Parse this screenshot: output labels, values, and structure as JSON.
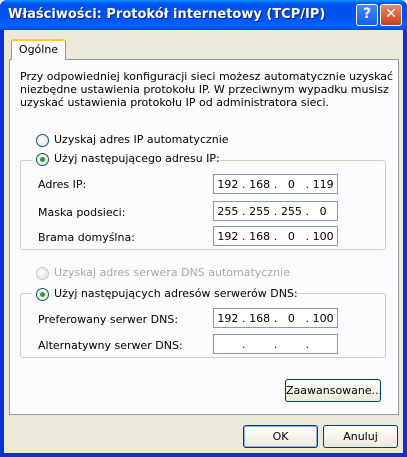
{
  "window": {
    "title": "Właściwości: Protokół internetowy (TCP/IP)",
    "help_symbol": "?",
    "close_symbol": "✕"
  },
  "tab": {
    "label": "Ogólne"
  },
  "description": [
    "Przy odpowiedniej konfiguracji sieci możesz automatycznie uzyskać",
    "niezbędne ustawienia protokołu IP. W przeciwnym wypadku musisz",
    "uzyskać ustawienia protokołu IP od administratora sieci."
  ],
  "ip_mode": {
    "auto_label": "Uzyskaj adres IP automatycznie",
    "manual_label": "Użyj następującego adresu IP:",
    "selected": "manual"
  },
  "ip_fields": {
    "address": {
      "label": "Adres IP:",
      "octets": [
        "192",
        "168",
        "0",
        "119"
      ]
    },
    "mask": {
      "label": "Maska podsieci:",
      "octets": [
        "255",
        "255",
        "255",
        "0"
      ]
    },
    "gateway": {
      "label": "Brama domyślna:",
      "octets": [
        "192",
        "168",
        "0",
        "100"
      ]
    }
  },
  "dns_mode": {
    "auto_label": "Uzyskaj adres serwera DNS automatycznie",
    "manual_label": "Użyj następujących adresów serwerów DNS:",
    "selected": "manual",
    "auto_disabled": true
  },
  "dns_fields": {
    "preferred": {
      "label": "Preferowany serwer DNS:",
      "octets": [
        "192",
        "168",
        "0",
        "100"
      ]
    },
    "alternate": {
      "label": "Alternatywny serwer DNS:",
      "octets": [
        "",
        "",
        "",
        ""
      ]
    }
  },
  "buttons": {
    "advanced": "Zaawansowane...",
    "ok": "OK",
    "cancel": "Anuluj"
  }
}
